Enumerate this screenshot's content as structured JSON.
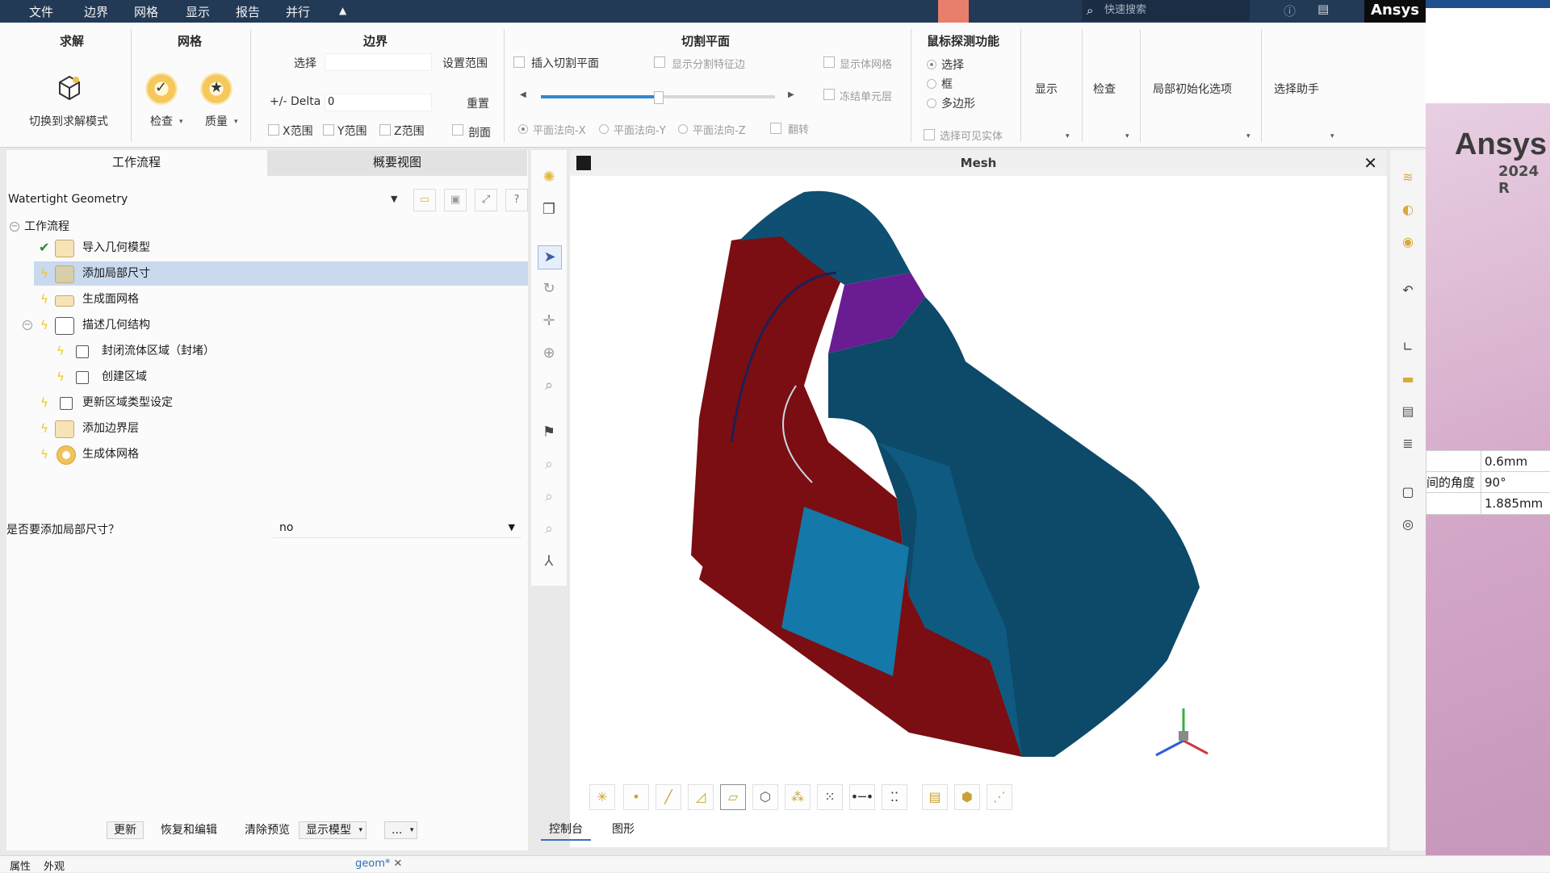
{
  "menubar": {
    "items": [
      "文件",
      "边界",
      "网格",
      "显示",
      "报告",
      "并行"
    ],
    "search_placeholder": "快速搜索",
    "brand": "Ansys"
  },
  "ribbon": {
    "solve": {
      "title": "求解",
      "switch_label": "切换到求解模式"
    },
    "mesh": {
      "title": "网格",
      "check_label": "检查",
      "quality_label": "质量"
    },
    "boundary": {
      "title": "边界",
      "select_label": "选择",
      "set_range_label": "设置范围",
      "delta_label": "+/- Delta",
      "delta_value": "0",
      "reset_label": "重置",
      "x_range": "X范围",
      "y_range": "Y范围",
      "z_range": "Z范围",
      "section_label": "剖面"
    },
    "cut_plane": {
      "title": "切割平面",
      "insert_label": "插入切割平面",
      "show_split_edges": "显示分割特征边",
      "show_volume_mesh": "显示体网格",
      "freeze_cells": "冻结单元层",
      "plane_x": "平面法向-X",
      "plane_y": "平面法向-Y",
      "plane_z": "平面法向-Z",
      "flip_label": "翻转",
      "slider_fraction": 0.5
    },
    "mouse_probe": {
      "title": "鼠标探测功能",
      "opt_select": "选择",
      "opt_box": "框",
      "opt_polygon": "多边形",
      "select_visible": "选择可见实体"
    },
    "display_label": "显示",
    "check_label": "检查",
    "local_init_label": "局部初始化选项",
    "select_helper_label": "选择助手"
  },
  "left": {
    "tab_workflow": "工作流程",
    "tab_overview": "概要视图",
    "workflow_type": "Watertight Geometry",
    "tree_root": "工作流程",
    "tree": [
      {
        "label": "导入几何模型",
        "status": "done"
      },
      {
        "label": "添加局部尺寸",
        "status": "pending",
        "selected": true
      },
      {
        "label": "生成面网格",
        "status": "pending"
      },
      {
        "label": "描述几何结构",
        "status": "pending"
      },
      {
        "label": "封闭流体区域（封堵）",
        "status": "pending"
      },
      {
        "label": "创建区域",
        "status": "pending"
      },
      {
        "label": "更新区域类型设定",
        "status": "pending"
      },
      {
        "label": "添加边界层",
        "status": "pending"
      },
      {
        "label": "生成体网格",
        "status": "pending"
      }
    ],
    "question_label": "是否要添加局部尺寸？",
    "question_value": "no",
    "buttons": {
      "update": "更新",
      "revert_edit": "恢复和编辑",
      "clear_preview": "清除预览",
      "show_model": "显示模型",
      "more": "..."
    }
  },
  "viewport": {
    "title": "Mesh",
    "tab_console": "控制台",
    "tab_graphics": "图形"
  },
  "background_app": {
    "logo": "Ansys",
    "version": "2024 R",
    "rows": [
      {
        "label": "",
        "value": "0.6mm"
      },
      {
        "label": "间的角度",
        "value": "90°"
      },
      {
        "label": "",
        "value": "1.885mm"
      }
    ]
  },
  "statusbar": {
    "tab_properties": "属性",
    "tab_appearance": "外观",
    "doc_tab": "geom*"
  }
}
